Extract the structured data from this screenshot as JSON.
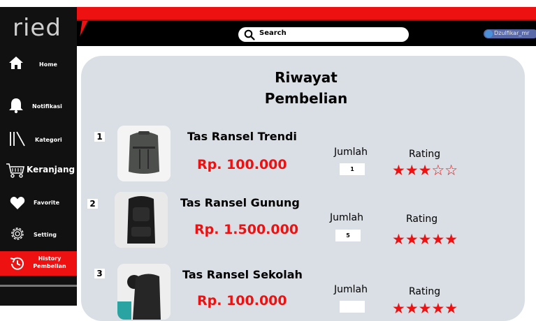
{
  "brand": {
    "logo_text": "ried"
  },
  "header": {
    "search_placeholder": "Search",
    "user_name": "Dzulfikar_mr"
  },
  "sidebar": {
    "items": [
      {
        "label": "Home"
      },
      {
        "label": "Notifikasi"
      },
      {
        "label": "Kategori"
      },
      {
        "label": "Keranjang"
      },
      {
        "label": "Favorite"
      },
      {
        "label": "Setting"
      },
      {
        "label": "History Pembelian",
        "line1": "History",
        "line2": "Pembelian"
      }
    ]
  },
  "page": {
    "title_line1": "Riwayat",
    "title_line2": "Pembelian"
  },
  "labels": {
    "jumlah": "Jumlah",
    "rating": "Rating"
  },
  "orders": [
    {
      "number": "1",
      "name": "Tas Ransel Trendi",
      "price": "Rp. 100.000",
      "quantity": "1",
      "rating": 3,
      "stars": "★★★☆☆"
    },
    {
      "number": "2",
      "name": "Tas Ransel Gunung",
      "price": "Rp. 1.500.000",
      "quantity": "5",
      "rating": 5,
      "stars": "★★★★★"
    },
    {
      "number": "3",
      "name": "Tas Ransel Sekolah",
      "price": "Rp. 100.000",
      "quantity": "",
      "rating": 5,
      "stars": "★★★★★"
    }
  ],
  "colors": {
    "accent": "#ee1111",
    "sidebar": "#111111",
    "panel": "#d9dfe4"
  }
}
